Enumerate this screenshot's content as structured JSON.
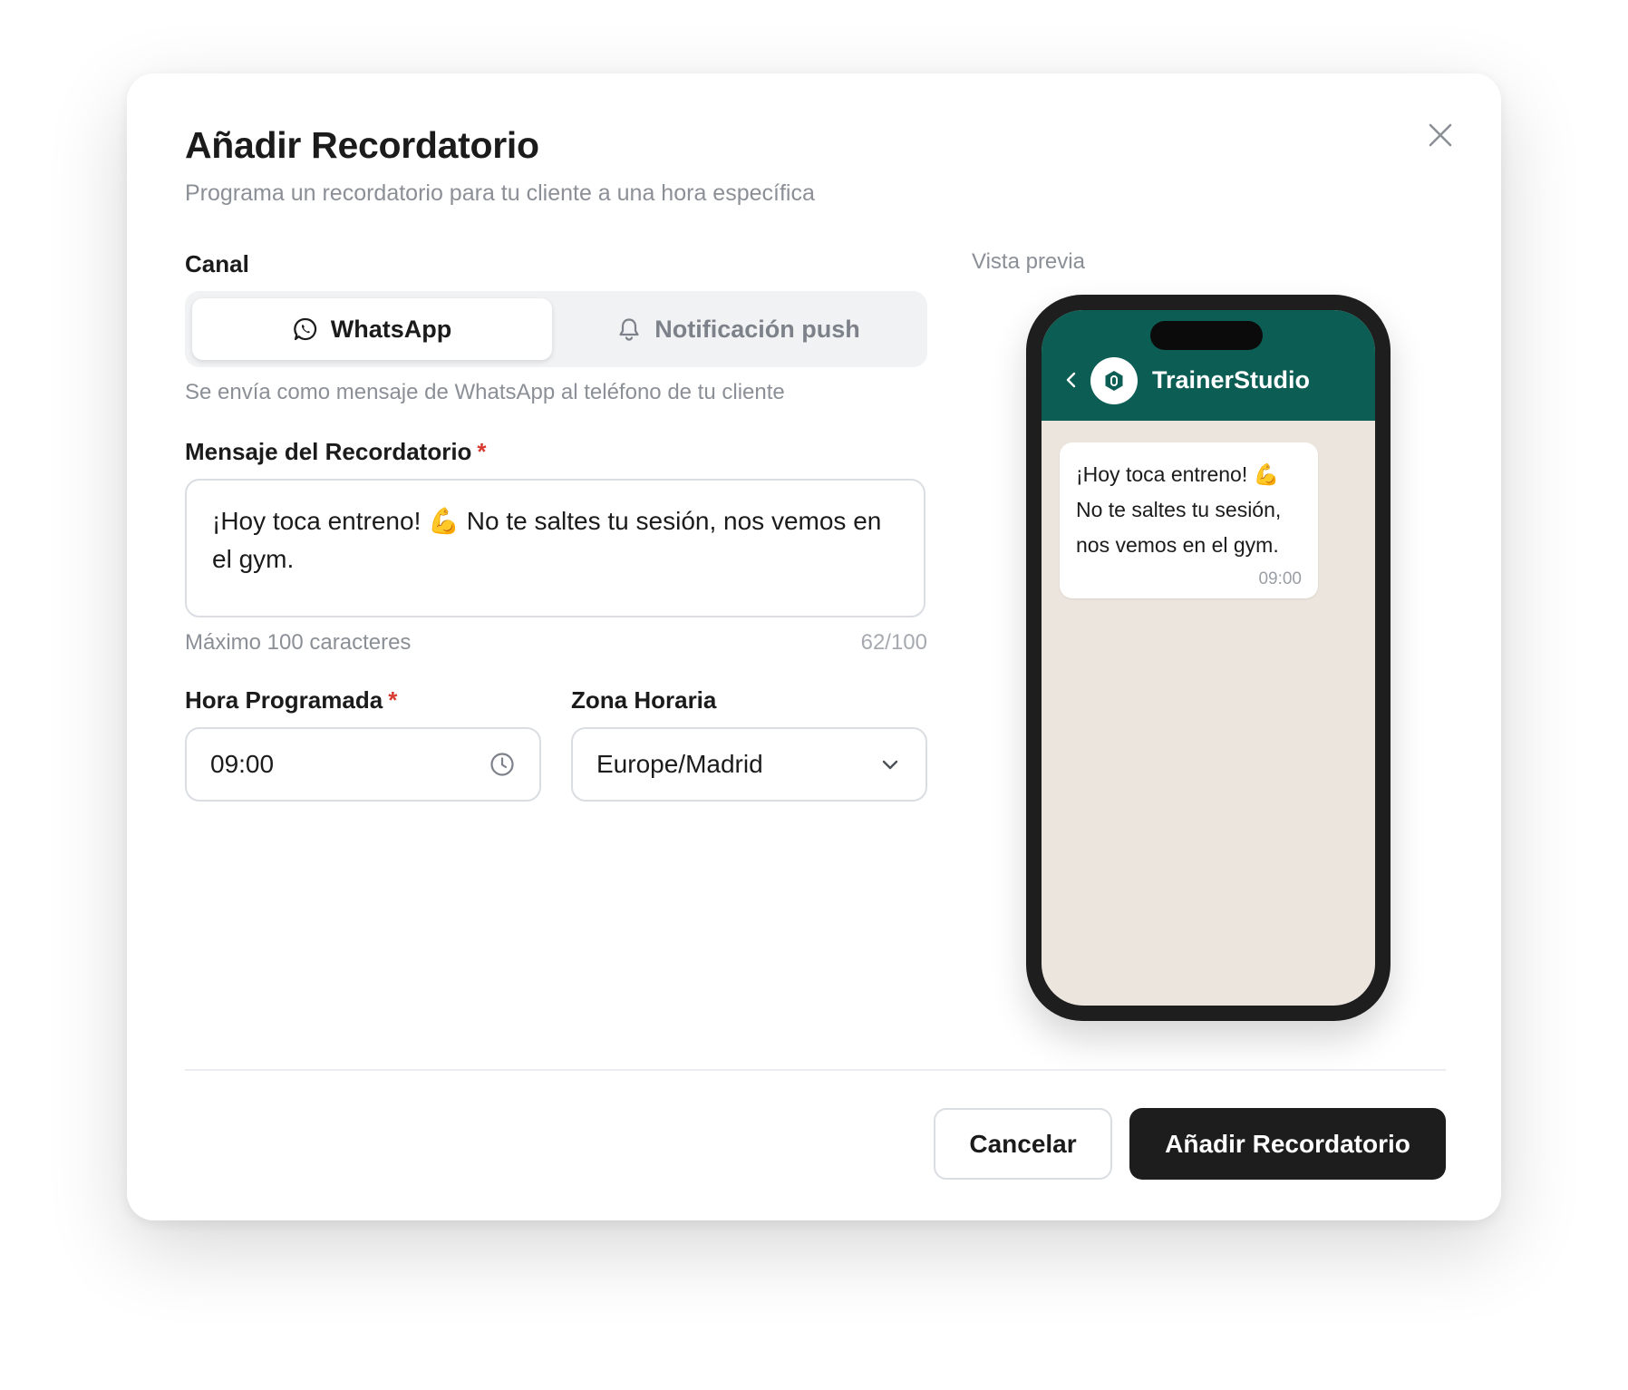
{
  "dialog": {
    "title": "Añadir Recordatorio",
    "subtitle": "Programa un recordatorio para tu cliente a una hora específica",
    "close_icon": "close-icon"
  },
  "channel": {
    "label": "Canal",
    "options": [
      {
        "label": "WhatsApp",
        "icon": "whatsapp-icon",
        "selected": true
      },
      {
        "label": "Notificación push",
        "icon": "bell-icon",
        "selected": false
      }
    ],
    "helper": "Se envía como mensaje de WhatsApp al teléfono de tu cliente"
  },
  "message": {
    "label": "Mensaje del Recordatorio",
    "required_mark": "*",
    "value": "¡Hoy toca entreno! 💪 No te saltes tu sesión, nos vemos en el gym.",
    "hint": "Máximo 100 caracteres",
    "counter": "62/100"
  },
  "time": {
    "label": "Hora Programada",
    "required_mark": "*",
    "value": "09:00",
    "icon": "clock-icon"
  },
  "timezone": {
    "label": "Zona Horaria",
    "value": "Europe/Madrid",
    "icon": "chevron-down-icon"
  },
  "preview": {
    "label": "Vista previa",
    "contact_name": "TrainerStudio",
    "bubble_text": "¡Hoy toca entreno! 💪\nNo te saltes tu sesión,\nnos vemos en el gym.",
    "bubble_time": "09:00",
    "header_color": "#0c5d54",
    "chat_bg_color": "#ebe5dd"
  },
  "actions": {
    "cancel": "Cancelar",
    "submit": "Añadir Recordatorio"
  }
}
